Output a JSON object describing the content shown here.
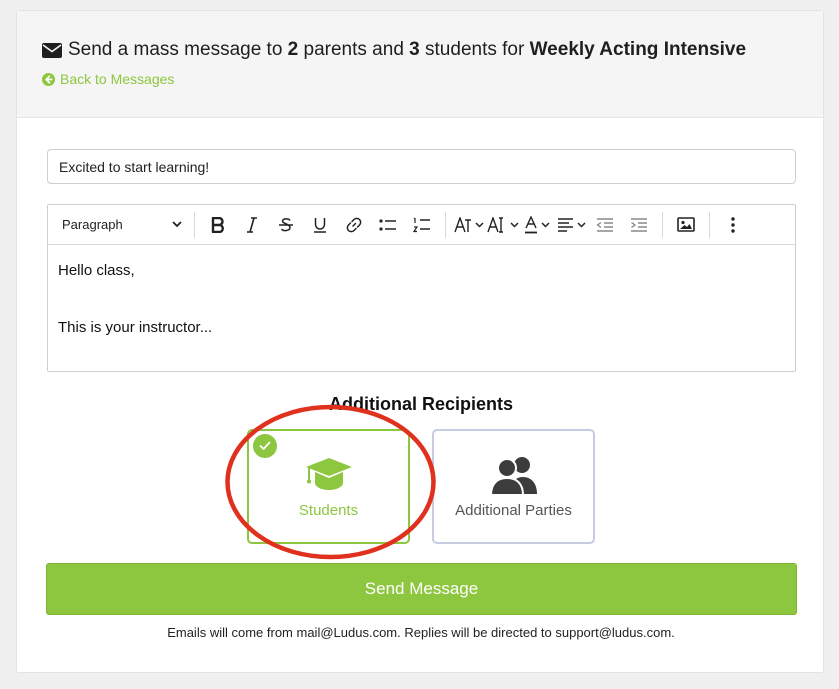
{
  "header": {
    "title_prefix": "Send a mass message to",
    "parents_count": "2",
    "parents_word": "parents and",
    "students_count": "3",
    "students_word": "students for",
    "class_name": "Weekly Acting Intensive",
    "back_link": "Back to Messages"
  },
  "subject": {
    "value": "Excited to start learning!"
  },
  "editor": {
    "block_format": "Paragraph",
    "toolbar_icons": [
      "bold-icon",
      "italic-icon",
      "strikethrough-icon",
      "underline-icon",
      "link-icon",
      "bullet-list-icon",
      "numbered-list-icon",
      "font-family-icon",
      "font-size-icon",
      "text-color-icon",
      "align-icon",
      "outdent-icon",
      "indent-icon",
      "image-icon",
      "more-icon"
    ],
    "body_lines": [
      "Hello class,",
      "This is your instructor..."
    ]
  },
  "recipients": {
    "heading": "Additional Recipients",
    "options": [
      {
        "label": "Students",
        "icon": "graduation-cap-icon",
        "selected": true
      },
      {
        "label": "Additional Parties",
        "icon": "users-icon",
        "selected": false
      }
    ]
  },
  "send_button": "Send Message",
  "footer_note": "Emails will come from mail@Ludus.com. Replies will be directed to support@ludus.com.",
  "colors": {
    "accent": "#8dc63f",
    "annotation": "#e0311f",
    "tile_border_inactive": "#c8cce0"
  }
}
